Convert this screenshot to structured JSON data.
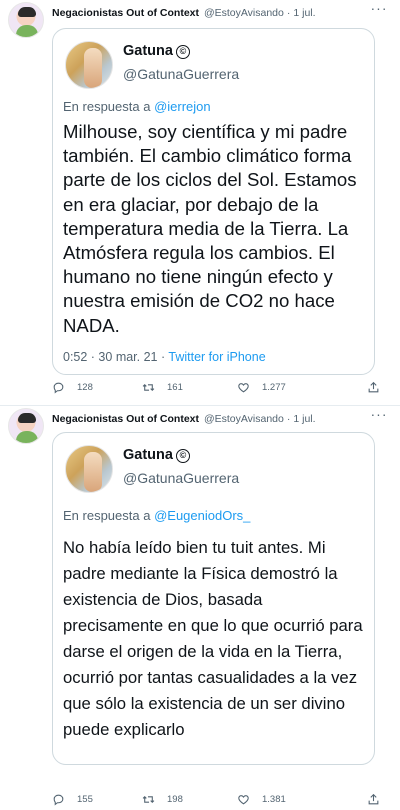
{
  "tweets": [
    {
      "account": {
        "name": "Negacionistas Out of Context",
        "handle": "@EstoyAvisando",
        "date": "1 jul."
      },
      "quoted": {
        "name": "Gatuna",
        "badge": "©",
        "handle": "@GatunaGuerrera",
        "reply_prefix": "En respuesta a",
        "reply_to": "@ierrejon",
        "text": "Milhouse, soy científica y mi padre también. El cambio climático forma parte de los ciclos del Sol. Estamos en era glaciar, por debajo de la temperatura media de la Tierra. La Atmósfera regula los cambios. El humano no tiene ningún efecto y nuestra emisión de CO2 no hace NADA.",
        "time": "0:52 · 30 mar. 21 · ",
        "source": "Twitter for iPhone"
      },
      "stats": {
        "replies": "128",
        "retweets": "161",
        "likes": "1.277"
      }
    },
    {
      "account": {
        "name": "Negacionistas Out of Context",
        "handle": "@EstoyAvisando",
        "date": "1 jul."
      },
      "quoted": {
        "name": "Gatuna",
        "badge": "©",
        "handle": "@GatunaGuerrera",
        "reply_prefix": "En respuesta a",
        "reply_to": "@EugeniodOrs_",
        "text": "No había leído bien tu tuit antes. Mi padre mediante la Física demostró la existencia de Dios, basada precisamente en que lo que ocurrió para darse el origen de la vida en la Tierra, ocurrió por tantas casualidades a la vez que sólo la existencia de un ser divino puede explicarlo"
      },
      "stats": {
        "replies": "155",
        "retweets": "198",
        "likes": "1.381"
      }
    }
  ],
  "icons": [
    "more-icon",
    "reply-icon",
    "retweet-icon",
    "like-icon",
    "share-icon",
    "copyright-icon"
  ],
  "colors": {
    "link": "#1d9bf0",
    "muted": "#536471",
    "border": "#cfd9de"
  }
}
